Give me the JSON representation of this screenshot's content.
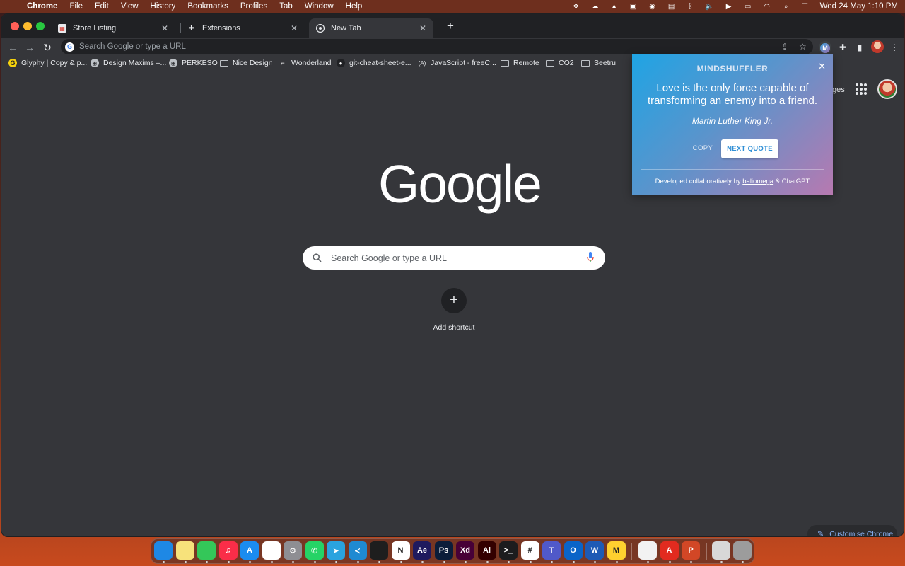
{
  "menubar": {
    "app_name": "Chrome",
    "menus": [
      "File",
      "Edit",
      "View",
      "History",
      "Bookmarks",
      "Profiles",
      "Tab",
      "Window",
      "Help"
    ],
    "clock": "Wed 24 May  1:10 PM"
  },
  "tabs": [
    {
      "title": "Store Listing",
      "icon": "store-listing-icon",
      "active": false
    },
    {
      "title": "Extensions",
      "icon": "puzzle-icon",
      "active": false
    },
    {
      "title": "New Tab",
      "icon": "chrome-icon",
      "active": true
    }
  ],
  "omnibox": {
    "placeholder": "Search Google or type a URL"
  },
  "extension_badge": "M",
  "bookmarks": [
    {
      "label": "Glyphy | Copy & p...",
      "icon": "glyphy-icon"
    },
    {
      "label": "Design Maxims –...",
      "icon": "globe-icon"
    },
    {
      "label": "PERKESO",
      "icon": "globe-icon"
    },
    {
      "label": "Nice Design",
      "icon": "folder-icon"
    },
    {
      "label": "Wonderland",
      "icon": "wonderland-icon"
    },
    {
      "label": "git-cheat-sheet-e...",
      "icon": "github-icon"
    },
    {
      "label": "JavaScript - freeC...",
      "icon": "freecodecamp-icon"
    },
    {
      "label": "Remote",
      "icon": "folder-icon"
    },
    {
      "label": "CO2",
      "icon": "folder-icon"
    },
    {
      "label": "Seetru",
      "icon": "folder-icon"
    }
  ],
  "newtab": {
    "images_link": "ges",
    "logo_text": "Google",
    "search_placeholder": "Search Google or type a URL",
    "add_shortcut_label": "Add shortcut",
    "customise_label": "Customise Chrome"
  },
  "popup": {
    "title": "MINDSHUFFLER",
    "quote": "Love is the only force capable of transforming an enemy into a friend.",
    "author": "Martin Luther King Jr.",
    "copy_label": "COPY",
    "next_label": "NEXT QUOTE",
    "credits_prefix": "Developed collaboratively by",
    "credits_link": "baliomega",
    "credits_suffix": "& ChatGPT"
  },
  "dock": [
    {
      "name": "finder",
      "label": "",
      "color": "#1e88e5"
    },
    {
      "name": "notes",
      "label": "",
      "color": "#f7e27b"
    },
    {
      "name": "messages",
      "label": "",
      "color": "#34c759"
    },
    {
      "name": "music",
      "label": "♫",
      "color": "#fa2d48"
    },
    {
      "name": "app-store",
      "label": "A",
      "color": "#1b8cf0"
    },
    {
      "name": "chrome",
      "label": "",
      "color": "#ffffff"
    },
    {
      "name": "system-preferences",
      "label": "⚙",
      "color": "#8e8e93"
    },
    {
      "name": "whatsapp",
      "label": "✆",
      "color": "#25d366"
    },
    {
      "name": "telegram",
      "label": "➤",
      "color": "#2aa3df"
    },
    {
      "name": "vscode",
      "label": "≺",
      "color": "#1f8ad2"
    },
    {
      "name": "figma",
      "label": "",
      "color": "#1e1e1e"
    },
    {
      "name": "notion",
      "label": "N",
      "color": "#ffffff"
    },
    {
      "name": "after-effects",
      "label": "Ae",
      "color": "#1f1a5e"
    },
    {
      "name": "photoshop",
      "label": "Ps",
      "color": "#0b1d3a"
    },
    {
      "name": "xd",
      "label": "Xd",
      "color": "#470137"
    },
    {
      "name": "illustrator",
      "label": "Ai",
      "color": "#330000"
    },
    {
      "name": "terminal",
      "label": ">_",
      "color": "#1c1c1e"
    },
    {
      "name": "slack",
      "label": "#",
      "color": "#ffffff"
    },
    {
      "name": "teams",
      "label": "T",
      "color": "#5059c9"
    },
    {
      "name": "outlook",
      "label": "O",
      "color": "#0a64c8"
    },
    {
      "name": "word",
      "label": "W",
      "color": "#1e5ab5"
    },
    {
      "name": "miro",
      "label": "M",
      "color": "#ffd02f"
    },
    {
      "name": "textedit",
      "label": "",
      "color": "#f2f2f2"
    },
    {
      "name": "acrobat",
      "label": "A",
      "color": "#e22b1f"
    },
    {
      "name": "powerpoint",
      "label": "P",
      "color": "#d24726"
    },
    {
      "name": "preview",
      "label": "",
      "color": "#d8d8d8"
    },
    {
      "name": "trash",
      "label": "",
      "color": "#9c9c9c"
    }
  ]
}
